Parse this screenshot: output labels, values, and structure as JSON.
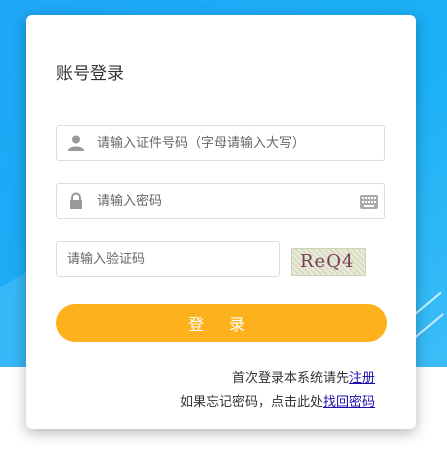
{
  "form": {
    "title": "账号登录",
    "id_placeholder": "请输入证件号码（字母请输入大写）",
    "password_placeholder": "请输入密码",
    "captcha_placeholder": "请输入验证码",
    "captcha_text": "ReQ4",
    "login_label": "登 录"
  },
  "footer": {
    "register_prefix": "首次登录本系统请先",
    "register_link": "注册",
    "forgot_prefix": "如果忘记密码，点击此处",
    "forgot_link": "找回密码"
  },
  "colors": {
    "background": "#1ea7f5",
    "button": "#fdb21d"
  }
}
